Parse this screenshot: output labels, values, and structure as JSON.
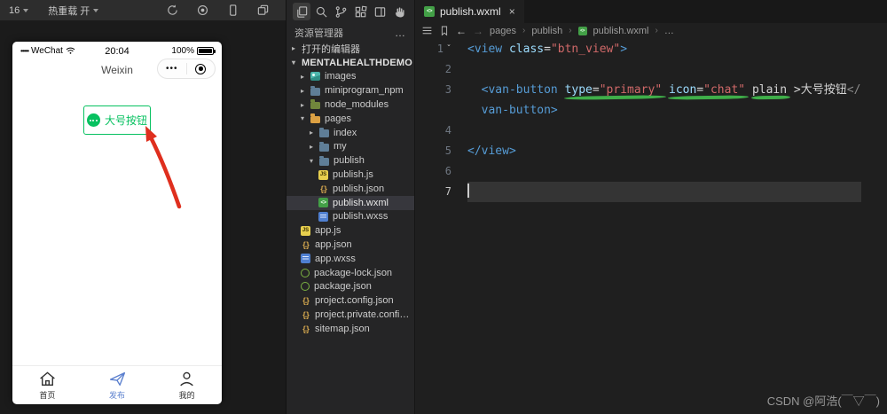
{
  "toolbar": {
    "device_label": "16",
    "hot_reload_label": "热重载 开",
    "icons": [
      "refresh-icon",
      "record-icon",
      "phone-icon",
      "windows-icon"
    ]
  },
  "simulator": {
    "status_bar": {
      "signal_dots": "•••••",
      "carrier": "WeChat",
      "time": "20:04",
      "battery_percent": "100%"
    },
    "nav": {
      "title": "Weixin",
      "capsule_dots": "•••"
    },
    "primary_button": {
      "label": "大号按钮",
      "icon": "chat-bubble-icon"
    },
    "tabbar": [
      {
        "label": "首页",
        "icon": "home-icon",
        "active": false
      },
      {
        "label": "发布",
        "icon": "paper-plane-icon",
        "active": true
      },
      {
        "label": "我的",
        "icon": "person-icon",
        "active": false
      }
    ]
  },
  "explorer": {
    "title": "资源管理器",
    "more_label": "…",
    "activity_icons": [
      "files-icon",
      "search-icon",
      "source-control-icon",
      "extensions-icon",
      "editor-layout-icon",
      "hand-icon"
    ],
    "tree": [
      {
        "label": "打开的编辑器",
        "arrow": "▸",
        "icon": "",
        "depth": 0
      },
      {
        "label": "MENTALHEALTHDEMO",
        "arrow": "▾",
        "icon": "",
        "depth": 0
      },
      {
        "label": "images",
        "arrow": "▸",
        "icon": "images-folder-icon",
        "depth": 1
      },
      {
        "label": "miniprogram_npm",
        "arrow": "▸",
        "icon": "folder-blue-icon",
        "depth": 1
      },
      {
        "label": "node_modules",
        "arrow": "▸",
        "icon": "folder-green-icon",
        "depth": 1
      },
      {
        "label": "pages",
        "arrow": "▾",
        "icon": "folder-orange-icon",
        "depth": 1
      },
      {
        "label": "index",
        "arrow": "▸",
        "icon": "folder-blue-icon",
        "depth": 2
      },
      {
        "label": "my",
        "arrow": "▸",
        "icon": "folder-blue-icon",
        "depth": 2
      },
      {
        "label": "publish",
        "arrow": "▾",
        "icon": "folder-blue-icon",
        "depth": 2
      },
      {
        "label": "publish.js",
        "arrow": "",
        "icon": "js-file-icon",
        "depth": 3
      },
      {
        "label": "publish.json",
        "arrow": "",
        "icon": "json-file-icon",
        "depth": 3
      },
      {
        "label": "publish.wxml",
        "arrow": "",
        "icon": "wxml-file-icon",
        "depth": 3,
        "selected": true
      },
      {
        "label": "publish.wxss",
        "arrow": "",
        "icon": "wxss-file-icon",
        "depth": 3
      },
      {
        "label": "app.js",
        "arrow": "",
        "icon": "js-file-icon",
        "depth": 1
      },
      {
        "label": "app.json",
        "arrow": "",
        "icon": "json-file-icon",
        "depth": 1
      },
      {
        "label": "app.wxss",
        "arrow": "",
        "icon": "wxss-file-icon",
        "depth": 1
      },
      {
        "label": "package-lock.json",
        "arrow": "",
        "icon": "npm-file-icon",
        "depth": 1
      },
      {
        "label": "package.json",
        "arrow": "",
        "icon": "npm-file-icon",
        "depth": 1
      },
      {
        "label": "project.config.json",
        "arrow": "",
        "icon": "json-file-icon",
        "depth": 1
      },
      {
        "label": "project.private.config.js...",
        "arrow": "",
        "icon": "json-file-icon",
        "depth": 1
      },
      {
        "label": "sitemap.json",
        "arrow": "",
        "icon": "json-file-icon",
        "depth": 1
      }
    ]
  },
  "editor": {
    "tab": {
      "label": "publish.wxml",
      "close": "×"
    },
    "nav_back": "←",
    "nav_forward": "→",
    "breadcrumb": {
      "items": [
        "pages",
        "publish",
        "publish.wxml",
        "…"
      ],
      "separator": "›"
    },
    "fold_glyph": "ˇ",
    "line_numbers": [
      "1",
      "2",
      "3",
      "4",
      "5",
      "6",
      "7"
    ],
    "code": {
      "l1": [
        "<view",
        " ",
        "class",
        "=",
        "\"btn_view\"",
        ">"
      ],
      "l3": [
        "  ",
        "<van-button",
        " ",
        "type",
        "=",
        "\"primary\"",
        " ",
        "icon",
        "=",
        "\"chat\"",
        " ",
        "plain",
        " >",
        "大号按钮",
        "</"
      ],
      "l3b": "van-button>",
      "l5": "</view>"
    }
  },
  "watermark": "CSDN @阿浩(￣▽￣)",
  "colors": {
    "wechat_green": "#07c160",
    "tabbar_active_blue": "#5a7fce",
    "arrow_red": "#df2f1e",
    "marker_green": "#3fae49",
    "selected_row_bg": "#37373d",
    "tag_blue": "#569cd6",
    "attr_cyan": "#9cdcfe",
    "string_red": "#d16969"
  }
}
